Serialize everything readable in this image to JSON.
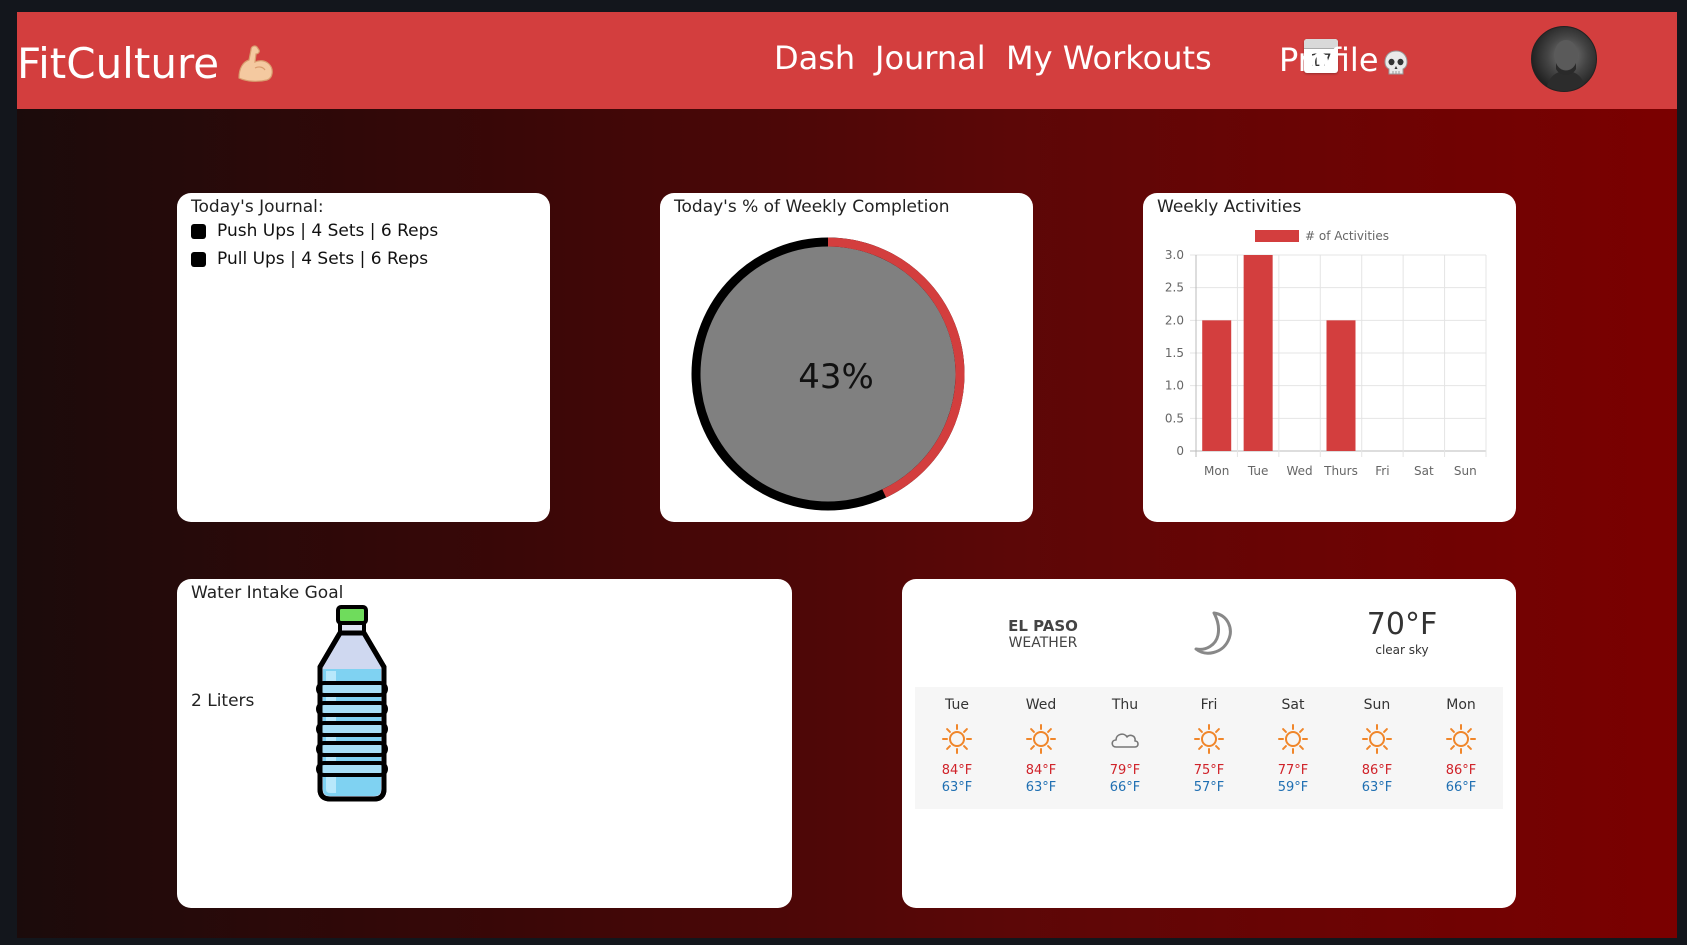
{
  "nav": {
    "brand": "FitCulture",
    "links": [
      "Dash",
      "Journal",
      "My Workouts"
    ],
    "calendar_day": "17",
    "profile": "Profile",
    "icons": {
      "brand": "flexed-biceps-icon",
      "calendar": "calendar-icon",
      "profile": "skull-icon"
    }
  },
  "journal": {
    "title": "Today's Journal:",
    "items": [
      "Push Ups | 4 Sets | 6 Reps",
      "Pull Ups | 4 Sets | 6 Reps"
    ]
  },
  "completion": {
    "title": "Today's % of Weekly Completion",
    "label": "43%",
    "value": 0.43,
    "colors": {
      "done": "#d33e3e",
      "remaining": "#000000",
      "center": "#808080"
    }
  },
  "activities": {
    "title": "Weekly Activities"
  },
  "chart_data": {
    "type": "bar",
    "title": "Weekly Activities",
    "categories": [
      "Mon",
      "Tue",
      "Wed",
      "Thurs",
      "Fri",
      "Sat",
      "Sun"
    ],
    "series": [
      {
        "name": "# of Activities",
        "values": [
          2,
          3,
          0,
          2,
          0,
          0,
          0
        ]
      }
    ],
    "ylim": [
      0,
      3
    ],
    "yticks": [
      "3.0",
      "2.5",
      "2.0",
      "1.5",
      "1.0",
      "0.5",
      "0"
    ],
    "ytick_values": [
      3,
      2.5,
      2,
      1.5,
      1,
      0.5,
      0
    ],
    "grid": true,
    "legend": "top",
    "color": "#d33e3e"
  },
  "water": {
    "title": "Water Intake Goal",
    "amount": "2 Liters",
    "icon": "water-bottle-icon"
  },
  "weather": {
    "city": "EL PASO",
    "label": "WEATHER",
    "current_temp": "70°F",
    "condition": "clear sky",
    "current_icon": "moon-icon",
    "days": [
      {
        "day": "Tue",
        "icon": "sun",
        "high": "84°F",
        "low": "63°F"
      },
      {
        "day": "Wed",
        "icon": "sun",
        "high": "84°F",
        "low": "63°F"
      },
      {
        "day": "Thu",
        "icon": "cloud",
        "high": "79°F",
        "low": "66°F"
      },
      {
        "day": "Fri",
        "icon": "sun",
        "high": "75°F",
        "low": "57°F"
      },
      {
        "day": "Sat",
        "icon": "sun",
        "high": "77°F",
        "low": "59°F"
      },
      {
        "day": "Sun",
        "icon": "sun",
        "high": "86°F",
        "low": "63°F"
      },
      {
        "day": "Mon",
        "icon": "sun",
        "high": "86°F",
        "low": "66°F"
      }
    ]
  }
}
